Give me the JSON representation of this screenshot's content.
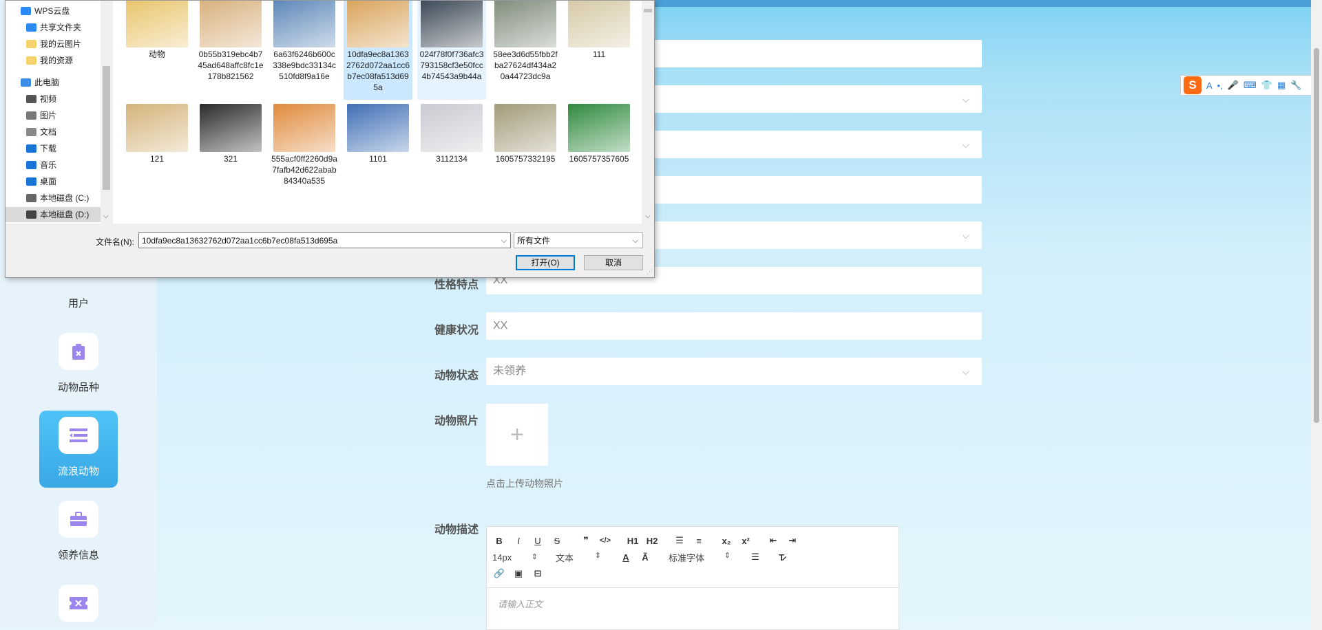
{
  "sidebar": {
    "items": [
      {
        "label": "用户",
        "active": false
      },
      {
        "label": "动物品种",
        "active": false
      },
      {
        "label": "流浪动物",
        "active": true
      },
      {
        "label": "领养信息",
        "active": false
      }
    ]
  },
  "form": {
    "fields": [
      {
        "label": "性格特点",
        "value": "XX"
      },
      {
        "label": "健康状况",
        "value": "XX"
      },
      {
        "label": "动物状态",
        "value": "未领养"
      }
    ],
    "photo_label": "动物照片",
    "upload_plus": "+",
    "upload_hint": "点击上传动物照片",
    "description_label": "动物描述"
  },
  "editor": {
    "buttons_row1": [
      "B",
      "I",
      "U",
      "S",
      "❞",
      "</>",
      "H1",
      "H2",
      "☰",
      "≡",
      "x₂",
      "x²",
      "⇤",
      "⇥"
    ],
    "font_size": "14px",
    "header_select": "文本",
    "font_select": "标准字体",
    "placeholder": "请输入正文"
  },
  "dialog": {
    "tree": [
      {
        "label": "WPS云盘",
        "color": "#2b8af7"
      },
      {
        "label": "共享文件夹",
        "color": "#2b8af7"
      },
      {
        "label": "我的云图片",
        "color": "#f5d36b"
      },
      {
        "label": "我的资源",
        "color": "#f5d36b"
      },
      {
        "label": "此电脑",
        "color": "#3a8ee6"
      },
      {
        "label": "视频",
        "color": "#555"
      },
      {
        "label": "图片",
        "color": "#777"
      },
      {
        "label": "文档",
        "color": "#888"
      },
      {
        "label": "下载",
        "color": "#1a73d8"
      },
      {
        "label": "音乐",
        "color": "#1a73d8"
      },
      {
        "label": "桌面",
        "color": "#1a73d8"
      },
      {
        "label": "本地磁盘 (C:)",
        "color": "#666"
      },
      {
        "label": "本地磁盘 (D:)",
        "color": "#444"
      }
    ],
    "files": [
      {
        "name": "动物",
        "color": "#e9c46a"
      },
      {
        "name": "0b55b319ebc4b745ad648affc8fc1e178b821562",
        "color": "#d8b07c"
      },
      {
        "name": "6a63f6246b600c338e9bdc33134c510fd8f9a16e",
        "color": "#5b86b8"
      },
      {
        "name": "10dfa9ec8a13632762d072aa1cc6b7ec08fa513d695a",
        "color": "#d9a35a"
      },
      {
        "name": "024f78f0f736afc3793158cf3e50fcc4b74543a9b44a",
        "color": "#3a4755"
      },
      {
        "name": "58ee3d6d55fbb2fba27624df434a20a44723dc9a",
        "color": "#7f8c7a"
      },
      {
        "name": "111",
        "color": "#d6c9a6"
      },
      {
        "name": "121",
        "color": "#d4b47a"
      },
      {
        "name": "321",
        "color": "#2a2a2a"
      },
      {
        "name": "555acf0ff2260d9a7fafb42d622abab84340a535",
        "color": "#e08a3c"
      },
      {
        "name": "1101",
        "color": "#3f6fb5"
      },
      {
        "name": "3112134",
        "color": "#c9c9d1"
      },
      {
        "name": "1605757332195",
        "color": "#a39a7a"
      },
      {
        "name": "1605757357605",
        "color": "#2f8a3e"
      }
    ],
    "filename_label": "文件名(N):",
    "filename_value": "10dfa9ec8a13632762d072aa1cc6b7ec08fa513d695a",
    "filetype_value": "所有文件",
    "open_button": "打开(O)",
    "cancel_button": "取消"
  },
  "ime": {
    "logo": "S",
    "items": [
      "A",
      "•,",
      "🎤",
      "⌨",
      "👕",
      "▦",
      "🔧"
    ]
  }
}
